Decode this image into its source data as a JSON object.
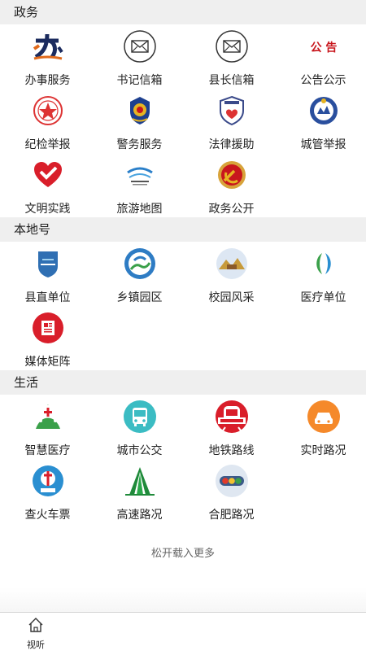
{
  "sections": [
    {
      "title": "政务",
      "items": [
        {
          "label": "办事服务",
          "icon": "ban-logo-icon"
        },
        {
          "label": "书记信箱",
          "icon": "mail-icon"
        },
        {
          "label": "县长信箱",
          "icon": "mail-icon"
        },
        {
          "label": "公告公示",
          "icon": "announcement-icon",
          "icon_text": "公 告"
        },
        {
          "label": "纪检举报",
          "icon": "discipline-emblem-icon"
        },
        {
          "label": "警务服务",
          "icon": "police-badge-icon"
        },
        {
          "label": "法律援助",
          "icon": "legal-aid-shield-icon"
        },
        {
          "label": "城管举报",
          "icon": "city-management-badge-icon"
        },
        {
          "label": "文明实践",
          "icon": "heart-logo-icon"
        },
        {
          "label": "旅游地图",
          "icon": "tourism-logo-icon"
        },
        {
          "label": "政务公开",
          "icon": "party-emblem-icon"
        }
      ]
    },
    {
      "title": "本地号",
      "items": [
        {
          "label": "县直单位",
          "icon": "county-shield-icon"
        },
        {
          "label": "乡镇园区",
          "icon": "township-park-icon"
        },
        {
          "label": "校园风采",
          "icon": "campus-icon"
        },
        {
          "label": "医疗单位",
          "icon": "medical-leaf-icon"
        },
        {
          "label": "媒体矩阵",
          "icon": "media-newspaper-icon"
        }
      ]
    },
    {
      "title": "生活",
      "items": [
        {
          "label": "智慧医疗",
          "icon": "smart-medical-icon"
        },
        {
          "label": "城市公交",
          "icon": "bus-icon"
        },
        {
          "label": "地铁路线",
          "icon": "subway-icon"
        },
        {
          "label": "实时路况",
          "icon": "car-icon"
        },
        {
          "label": "查火车票",
          "icon": "railway-logo-icon"
        },
        {
          "label": "高速路况",
          "icon": "highway-icon"
        },
        {
          "label": "合肥路况",
          "icon": "traffic-light-icon"
        }
      ]
    }
  ],
  "load_more": "松开载入更多",
  "bottom_nav": {
    "tab_label": "视听",
    "tab_icon": "home-icon"
  }
}
